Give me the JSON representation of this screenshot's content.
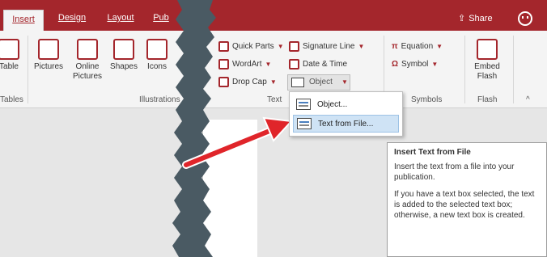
{
  "tabs": [
    {
      "label": "Insert",
      "active": true
    },
    {
      "label": "Design",
      "active": false
    },
    {
      "label": "Layout",
      "active": false
    },
    {
      "label": "Pub",
      "active": false
    }
  ],
  "share_label": "Share",
  "ribbon": {
    "table_label": "Table",
    "tables_group": "Tables",
    "pictures": "Pictures",
    "online_pictures": "Online Pictures",
    "shapes": "Shapes",
    "icons": "Icons",
    "illustrations_group": "Illustrations",
    "quick_parts": "Quick Parts",
    "wordart": "WordArt",
    "drop_cap": "Drop Cap",
    "text_group": "Text",
    "signature_line": "Signature Line",
    "date_time": "Date & Time",
    "object_label": "Object",
    "equation": "Equation",
    "symbol": "Symbol",
    "symbols_group": "Symbols",
    "embed_flash": "Embed Flash",
    "flash_group": "Flash"
  },
  "dropdown": {
    "items": [
      {
        "label": "Object...",
        "selected": false
      },
      {
        "label": "Text from File...",
        "selected": true
      }
    ]
  },
  "tooltip": {
    "title": "Insert Text from File",
    "p1": "Insert the text from a file into your publication.",
    "p2": "If you have a text box selected, the text is added to the selected text box; otherwise, a new text box is created."
  },
  "colors": {
    "accent": "#a4262c",
    "arrow": "#e0252a"
  }
}
